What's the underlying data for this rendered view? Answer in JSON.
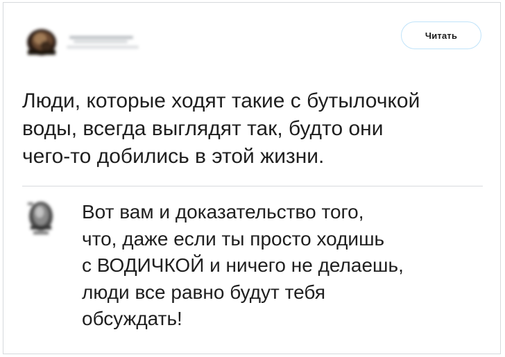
{
  "header": {
    "follow_label": "Читать"
  },
  "tweet": {
    "text": "Люди, которые ходят такие с бутылочкой\nводы, всегда выглядят так, будто они\nчего-то добились в этой жизни."
  },
  "reply": {
    "text": "Вот вам и доказательство того,\nчто, даже если ты просто ходишь\nс ВОДИЧКОЙ и ничего не делаешь,\nлюди все равно будут тебя\nобсуждать!"
  },
  "colors": {
    "follow_border": "#bfe3fa",
    "divider": "#d7dadd",
    "text": "#1f1f1f"
  },
  "icons": {
    "main_avatar": "blurred-avatar-icon",
    "reply_avatar": "blurred-avatar-icon"
  }
}
